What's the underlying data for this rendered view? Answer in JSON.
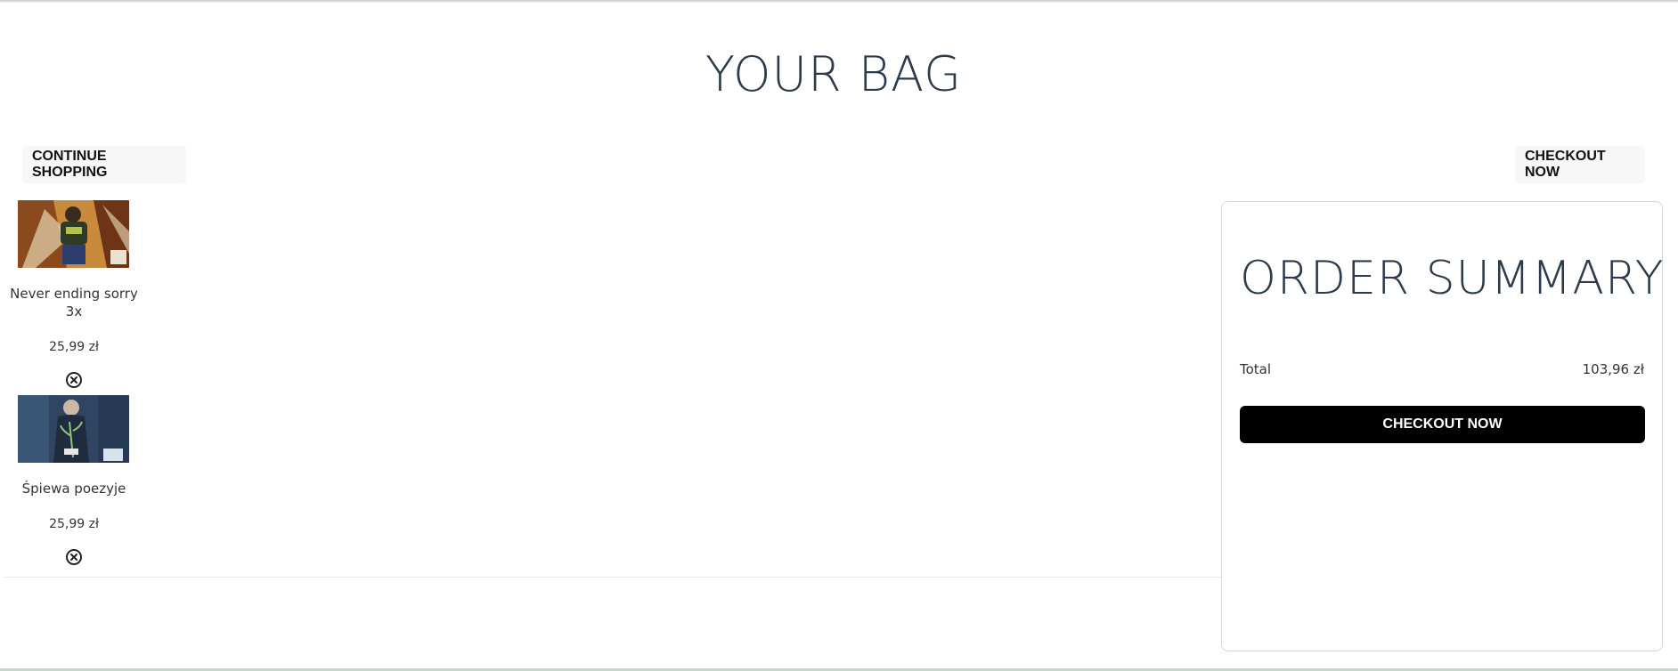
{
  "page": {
    "title": "YOUR BAG"
  },
  "actions": {
    "continue_label": "CONTINUE SHOPPING",
    "checkout_label": "CHECKOUT NOW"
  },
  "cart": {
    "items": [
      {
        "name": "Never ending sorry 3x",
        "price": "25,99 zł",
        "remove_icon": "circle-x-icon"
      },
      {
        "name": "Śpiewa poezyje",
        "price": "25,99 zł",
        "remove_icon": "circle-x-icon"
      }
    ]
  },
  "summary": {
    "title": "ORDER SUMMARY",
    "total_label": "Total",
    "total_value": "103,96 zł",
    "checkout_label": "CHECKOUT NOW"
  },
  "colors": {
    "title_text": "#2c3a4b",
    "primary_button": "#000000",
    "light_button": "#f7f7f7"
  }
}
